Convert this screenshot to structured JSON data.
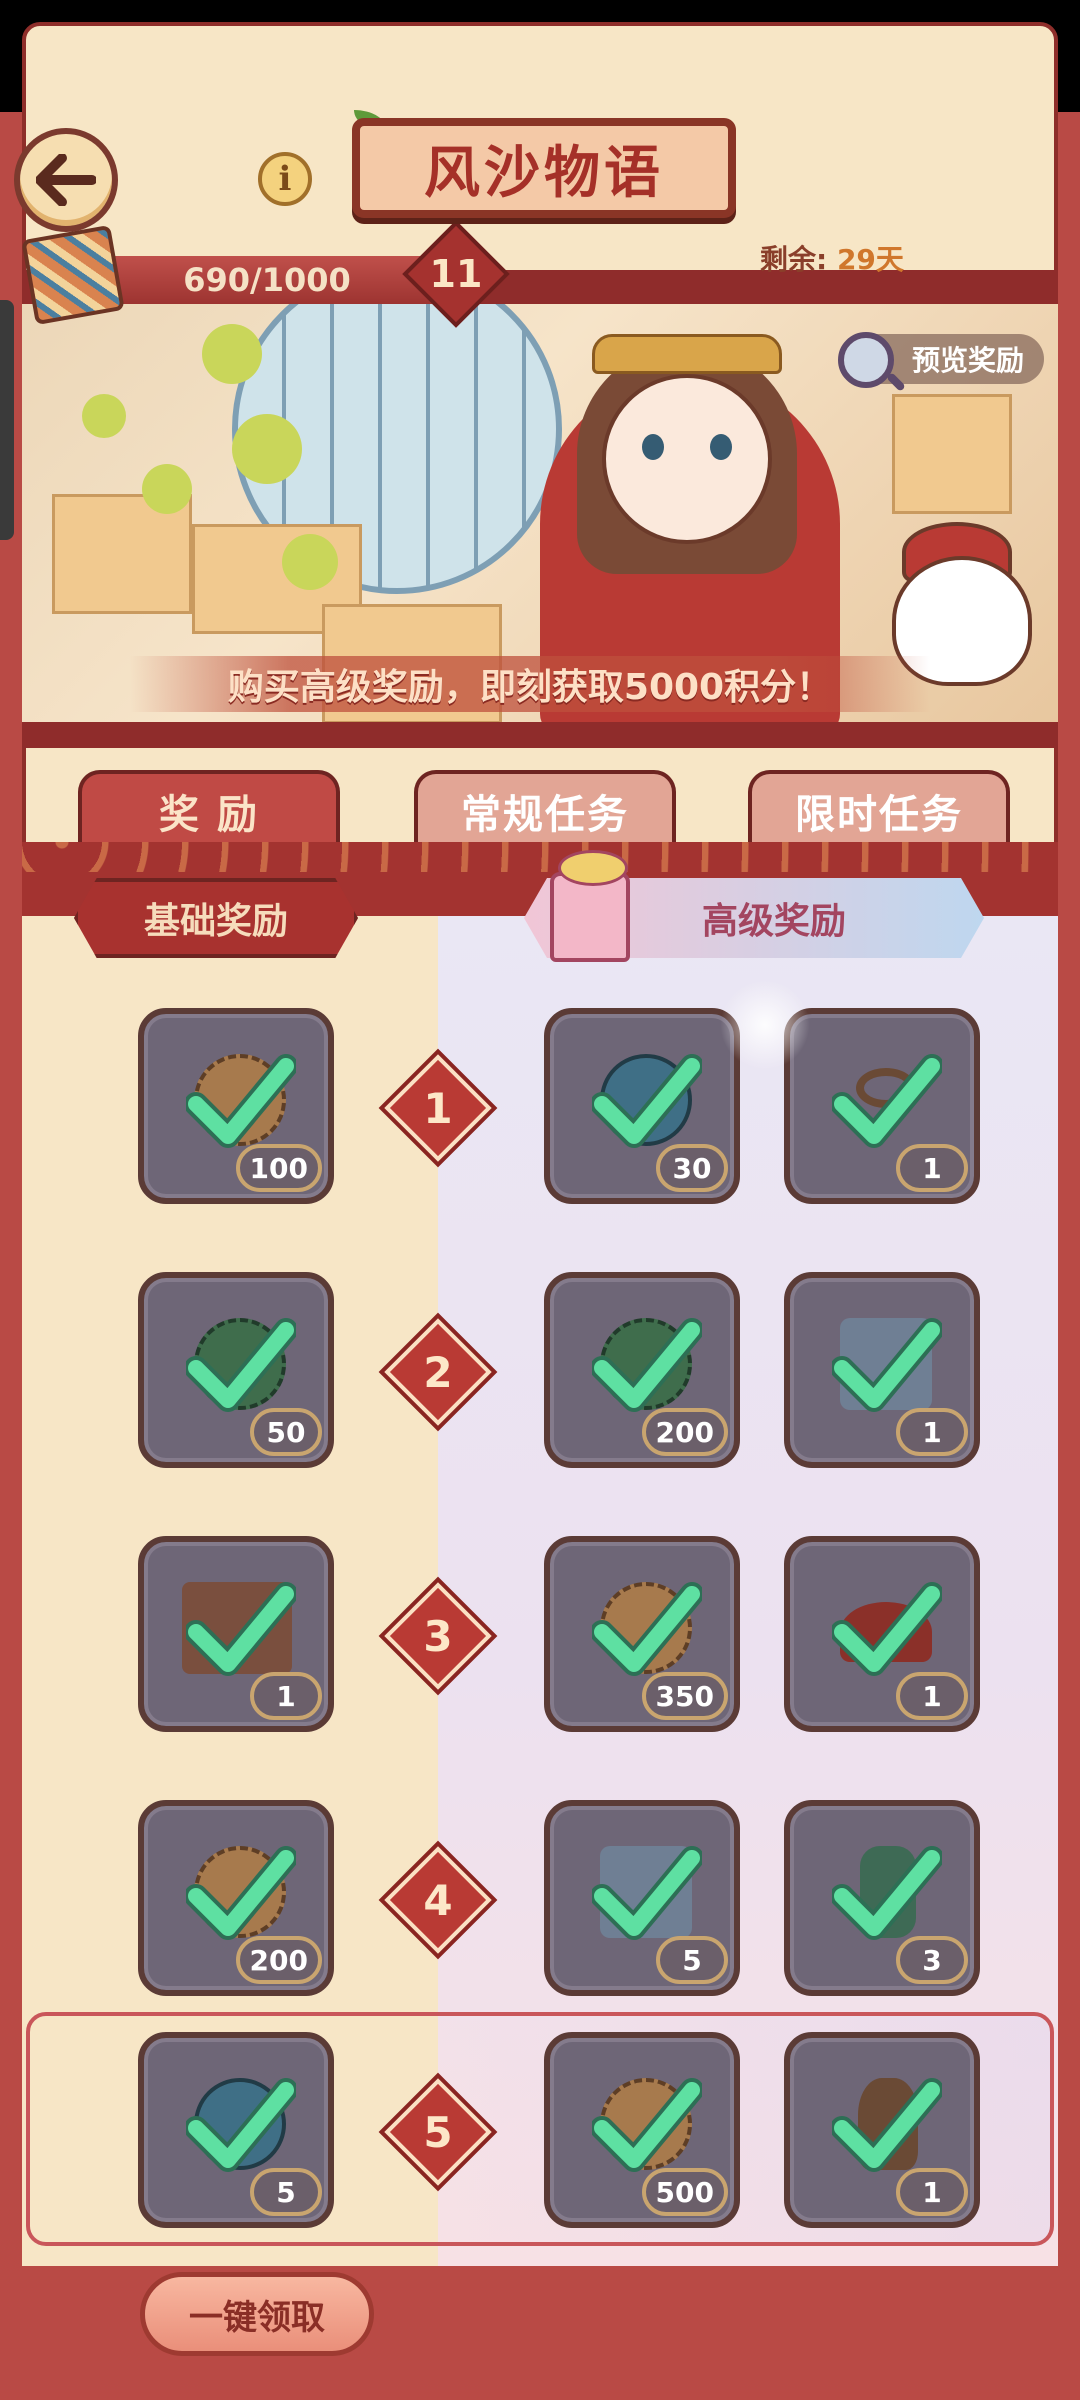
{
  "header": {
    "title": "风沙物语",
    "progress_text": "690/1000",
    "progress_fraction": 0.69,
    "level": "11",
    "remaining_label": "剩余:",
    "remaining_value": "29天"
  },
  "banner": {
    "preview_label": "预览奖励",
    "cta_text": "购买高级奖励，即刻获取5000积分！"
  },
  "tabs": [
    {
      "label": "奖 励",
      "active": true
    },
    {
      "label": "常规任务",
      "active": false
    },
    {
      "label": "限时任务",
      "active": false
    }
  ],
  "sections": {
    "basic": "基础奖励",
    "premium": "高级奖励"
  },
  "rows": [
    {
      "level": "1",
      "basic": {
        "item": "leaf-token",
        "qty": "100"
      },
      "premium": [
        {
          "item": "blue-token",
          "qty": "30"
        },
        {
          "item": "ring",
          "qty": "1"
        }
      ]
    },
    {
      "level": "2",
      "basic": {
        "item": "tea-token",
        "qty": "50"
      },
      "premium": [
        {
          "item": "tea-token",
          "qty": "200"
        },
        {
          "item": "scroll",
          "qty": "1"
        }
      ]
    },
    {
      "level": "3",
      "basic": {
        "item": "chest",
        "qty": "1"
      },
      "premium": [
        {
          "item": "leaf-token",
          "qty": "350"
        },
        {
          "item": "hat",
          "qty": "1"
        }
      ]
    },
    {
      "level": "4",
      "basic": {
        "item": "leaf-token",
        "qty": "200"
      },
      "premium": [
        {
          "item": "scroll",
          "qty": "5"
        },
        {
          "item": "bottle",
          "qty": "3"
        }
      ]
    },
    {
      "level": "5",
      "basic": {
        "item": "blue-token",
        "qty": "5"
      },
      "premium": [
        {
          "item": "leaf-token",
          "qty": "500"
        },
        {
          "item": "jug",
          "qty": "1"
        }
      ]
    }
  ],
  "claim_all_label": "一键领取",
  "colors": {
    "accent_red": "#b93a34",
    "check_green": "#5ee0a2",
    "cell_bg": "#6e6677"
  }
}
